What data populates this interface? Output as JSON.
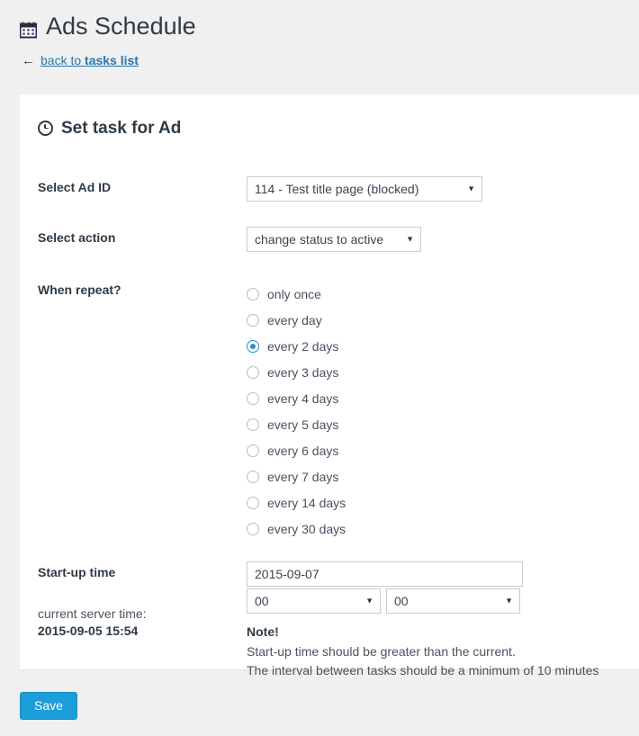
{
  "header": {
    "icon": "calendar-icon",
    "title": "Ads Schedule",
    "back_arrow": "←",
    "back_link_prefix": "back to ",
    "back_link_strong": "tasks list"
  },
  "panel": {
    "icon": "clock-icon",
    "title": "Set task for Ad",
    "fields": {
      "ad_id": {
        "label": "Select Ad ID",
        "value": "114 - Test title page (blocked)",
        "caret": "▼"
      },
      "action": {
        "label": "Select action",
        "value": "change status to active",
        "caret": "▼"
      },
      "repeat": {
        "label": "When repeat?",
        "selected": "every 2 days",
        "options": [
          "only once",
          "every day",
          "every 2 days",
          "every 3 days",
          "every 4 days",
          "every 5 days",
          "every 6 days",
          "every 7 days",
          "every 14 days",
          "every 30 days"
        ]
      },
      "startup": {
        "label": "Start-up time",
        "server_time_label": "current server time:",
        "server_time_value": "2015-09-05 15:54",
        "date_value": "2015-09-07",
        "date_placeholder": "2015-09-07",
        "hour_value": "00",
        "minute_value": "00",
        "caret": "▼",
        "note_title": "Note!",
        "note_line_1": "Start-up time should be greater than the current.",
        "note_line_2": "The interval between tasks should be a minimum of 10 minutes"
      }
    }
  },
  "footer": {
    "save_label": "Save"
  },
  "colors": {
    "accent": "#1b9dd9",
    "radio_selected": "#2d8fc9",
    "link": "#2a77ad",
    "page_bg": "#f0f0f0",
    "panel_bg": "#ffffff",
    "heading": "#2f3a45"
  }
}
